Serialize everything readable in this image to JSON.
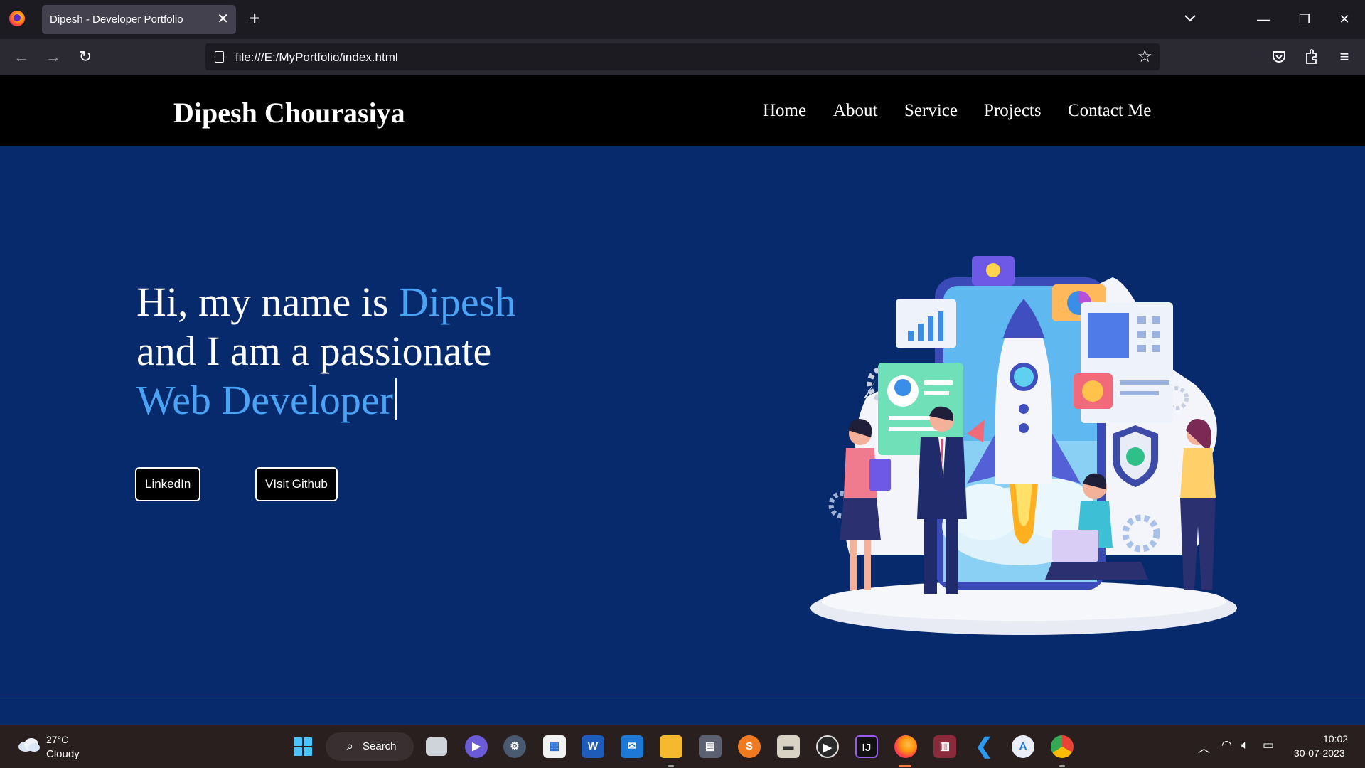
{
  "browser": {
    "tab_title": "Dipesh - Developer Portfolio",
    "tab_close": "✕",
    "new_tab": "+",
    "url": "file:///E:/MyPortfolio/index.html",
    "window_controls": {
      "minimize": "—",
      "restore": "❐",
      "close": "✕"
    }
  },
  "site": {
    "brand": "Dipesh Chourasiya",
    "menu": [
      "Home",
      "About",
      "Service",
      "Projects",
      "Contact Me"
    ],
    "hero": {
      "line1_prefix": "Hi, my name is ",
      "line1_name": "Dipesh",
      "line2": "and I am a passionate",
      "line3": "Web Developer"
    },
    "buttons": {
      "linkedin": "LinkedIn",
      "github": "VIsit Github"
    }
  },
  "taskbar": {
    "weather": {
      "temperature": "27°C",
      "condition": "Cloudy"
    },
    "search_label": "Search",
    "apps": [
      "task-view",
      "meet",
      "settings",
      "store",
      "word",
      "mail",
      "file-explorer",
      "calculator",
      "sublime",
      "archive",
      "media-player",
      "intellij",
      "firefox",
      "rar",
      "vscode",
      "app-installer",
      "chrome"
    ],
    "clock": {
      "time": "10:02",
      "date": "30-07-2023"
    }
  },
  "colors": {
    "page_background": "#072a6c",
    "accent_text": "#4aa3f5",
    "header_background": "#000000",
    "taskbar_background": "#2a1f1f"
  }
}
